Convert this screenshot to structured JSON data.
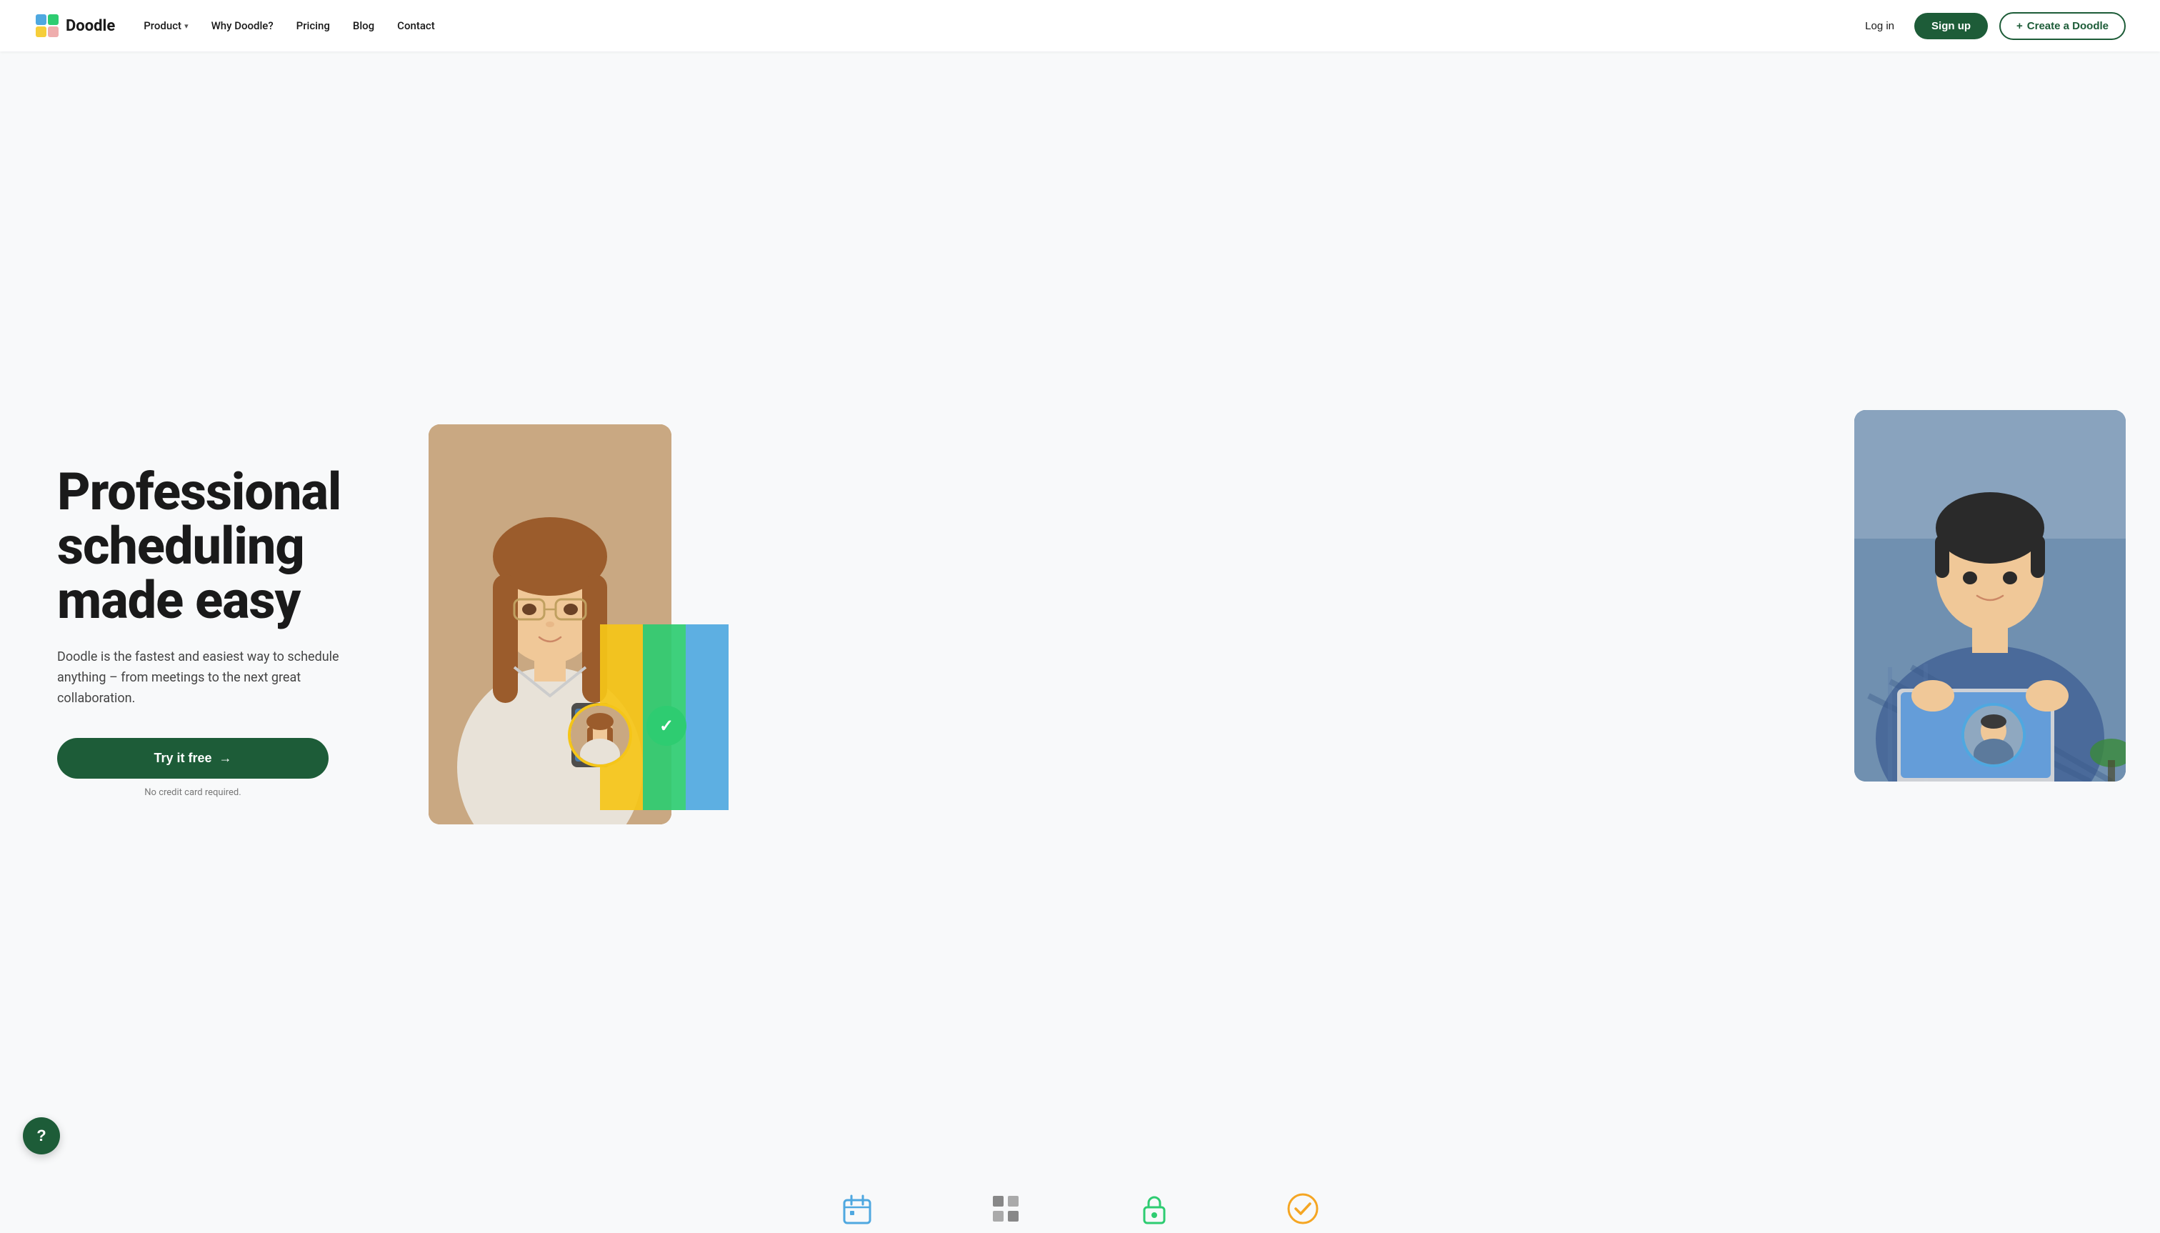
{
  "brand": {
    "name": "Doodle",
    "logo_alt": "Doodle logo"
  },
  "nav": {
    "links": [
      {
        "id": "product",
        "label": "Product",
        "has_dropdown": true
      },
      {
        "id": "why-doodle",
        "label": "Why Doodle?",
        "has_dropdown": false
      },
      {
        "id": "pricing",
        "label": "Pricing",
        "has_dropdown": false
      },
      {
        "id": "blog",
        "label": "Blog",
        "has_dropdown": false
      },
      {
        "id": "contact",
        "label": "Contact",
        "has_dropdown": false
      }
    ],
    "login_label": "Log in",
    "signup_label": "Sign up",
    "create_label": "Create a Doodle",
    "create_icon": "+"
  },
  "hero": {
    "title_line1": "Professional",
    "title_line2": "scheduling",
    "title_line3": "made easy",
    "subtitle": "Doodle is the fastest and easiest way to schedule anything – from meetings to the next great collaboration.",
    "cta_label": "Try it free",
    "cta_arrow": "→",
    "no_cc_text": "No credit card required."
  },
  "bottom_icons": [
    {
      "id": "calendar",
      "color": "#4fa8e0",
      "symbol": "🗓"
    },
    {
      "id": "grid",
      "color": "#888",
      "symbol": "⊞"
    },
    {
      "id": "lock",
      "color": "#2ecc71",
      "symbol": "🔒"
    },
    {
      "id": "check-badge",
      "color": "#f5a623",
      "symbol": "✓"
    }
  ],
  "help": {
    "label": "?",
    "bg_color": "#1d5c38"
  },
  "colors": {
    "brand_green": "#1d5c38",
    "bar_yellow": "#f5c518",
    "bar_green": "#2ecc71",
    "bar_blue": "#4fa8e0"
  }
}
